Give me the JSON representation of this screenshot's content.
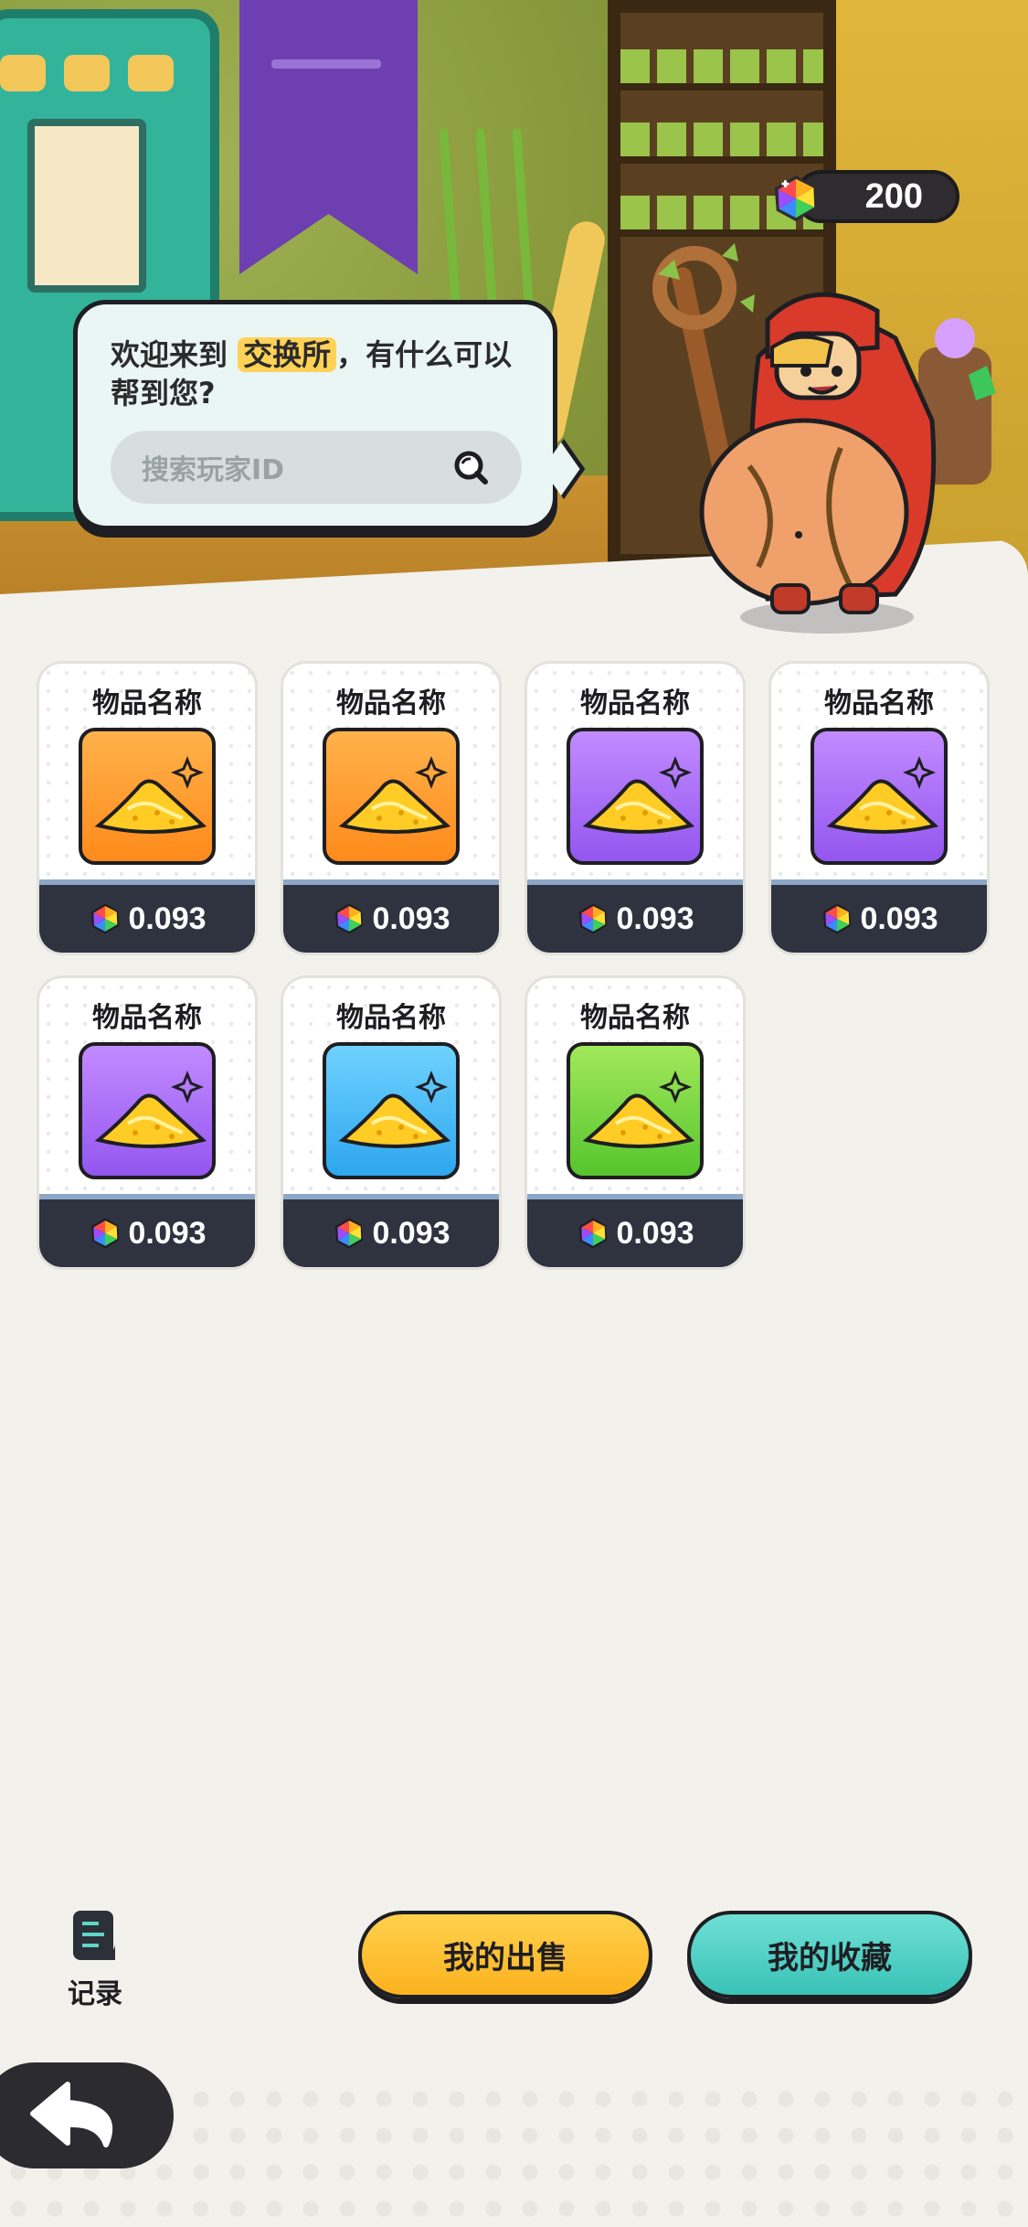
{
  "header": {
    "currency_icon": "rainbow-gem-icon",
    "currency_amount": "200"
  },
  "bubble": {
    "message_pre": "欢迎来到 ",
    "message_highlight": "交换所",
    "message_post": "，有什么可以帮到您?",
    "search_placeholder": "搜索玩家ID",
    "search_icon": "magnifier-icon"
  },
  "items": [
    {
      "name": "物品名称",
      "price": "0.093",
      "rarity": "orange",
      "icon": "gold-dust-pile-icon"
    },
    {
      "name": "物品名称",
      "price": "0.093",
      "rarity": "orange",
      "icon": "gold-dust-pile-icon"
    },
    {
      "name": "物品名称",
      "price": "0.093",
      "rarity": "purple",
      "icon": "gold-dust-pile-icon"
    },
    {
      "name": "物品名称",
      "price": "0.093",
      "rarity": "purple",
      "icon": "gold-dust-pile-icon"
    },
    {
      "name": "物品名称",
      "price": "0.093",
      "rarity": "purple",
      "icon": "gold-dust-pile-icon"
    },
    {
      "name": "物品名称",
      "price": "0.093",
      "rarity": "blue",
      "icon": "gold-dust-pile-icon"
    },
    {
      "name": "物品名称",
      "price": "0.093",
      "rarity": "green",
      "icon": "gold-dust-pile-icon"
    }
  ],
  "footer": {
    "record_label": "记录",
    "record_icon": "scroll-list-icon",
    "my_sales_label": "我的出售",
    "my_favorites_label": "我的收藏",
    "back_icon": "back-arrow-icon"
  },
  "colors": {
    "sell_button": "#fcb21e",
    "fav_button": "#39c2b6",
    "card_footer": "#2f3340",
    "highlight": "#ffd257"
  }
}
